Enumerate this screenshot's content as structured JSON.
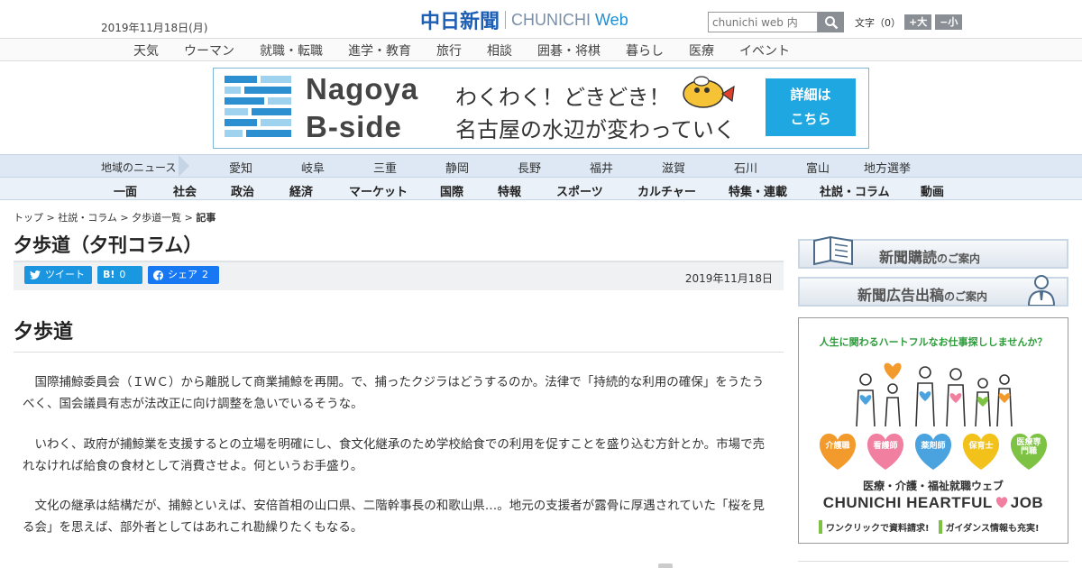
{
  "header": {
    "date": "2019年11月18日(月)",
    "logo_jp": "中日新聞",
    "logo_en": "CHUNICHI",
    "logo_web": "Web",
    "search_placeholder": "chunichi web 内",
    "font_label": "文字（0）",
    "font_larger": "+大",
    "font_smaller": "−小"
  },
  "category_nav": [
    "天気",
    "ウーマン",
    "就職・転職",
    "進学・教育",
    "旅行",
    "相談",
    "囲碁・将棋",
    "暮らし",
    "医療",
    "イベント"
  ],
  "banner": {
    "title_line1": "Nagoya",
    "title_line2": "B-side",
    "line1": "わくわく！どきどき！",
    "line2": "名古屋の水辺が変わっていく",
    "button_line1": "詳細は",
    "button_line2": "こちら"
  },
  "region_nav": {
    "label": "地域のニュース",
    "items": [
      "愛知",
      "岐阜",
      "三重",
      "静岡",
      "長野",
      "福井",
      "滋賀",
      "石川",
      "富山",
      "地方選挙"
    ]
  },
  "section_nav": [
    "一面",
    "社会",
    "政治",
    "経済",
    "マーケット",
    "国際",
    "特報",
    "スポーツ",
    "カルチャー",
    "特集・連載",
    "社説・コラム",
    "動画"
  ],
  "breadcrumb": {
    "items": [
      "トップ",
      "社説・コラム",
      "夕歩道一覧"
    ],
    "current": "記事",
    "sep": " > "
  },
  "article": {
    "page_title": "夕歩道（夕刊コラム）",
    "share": {
      "tweet": "ツイート",
      "hatena_icon": "B!",
      "hatena_count": "0",
      "facebook": "シェア",
      "facebook_count": "2"
    },
    "date": "2019年11月18日",
    "heading": "夕歩道",
    "paragraphs": [
      "国際捕鯨委員会（ＩＷＣ）から離脱して商業捕鯨を再開。で、捕ったクジラはどうするのか。法律で「持続的な利用の確保」をうたうべく、国会議員有志が法改正に向け調整を急いでいるそうな。",
      "いわく、政府が捕鯨業を支援するとの立場を明確にし、食文化継承のため学校給食での利用を促すことを盛り込む方針とか。市場で売れなければ給食の食材として消費させよ。何というお手盛り。",
      "文化の継承は結構だが、捕鯨といえば、安倍首相の山口県、二階幹事長の和歌山県…。地元の支援者が露骨に厚遇されていた「桜を見る会」を思えば、部外者としてはあれこれ勘繰りたくもなる。"
    ]
  },
  "sidebar": {
    "subscribe_main": "新聞購読",
    "subscribe_sub": "のご案内",
    "ad_main": "新聞広告出稿",
    "ad_sub": "のご案内",
    "job_ad": {
      "tagline": "人生に関わるハートフルなお仕事探ししませんか？",
      "hearts": [
        {
          "label": "介護職",
          "color": "#f39a2d"
        },
        {
          "label": "看護師",
          "color": "#f07fa0"
        },
        {
          "label": "薬剤師",
          "color": "#4aa3df"
        },
        {
          "label": "保育士",
          "color": "#f2c21a"
        },
        {
          "label": "医療専門職",
          "color": "#7dc242"
        }
      ],
      "subtitle": "医療・介護・福祉就職ウェブ",
      "brand": "CHUNICHI HEARTFUL",
      "brand_job": "JOB",
      "footer1": "ワンクリックで資料請求!",
      "footer2": "ガイダンス情報も充実!"
    }
  }
}
